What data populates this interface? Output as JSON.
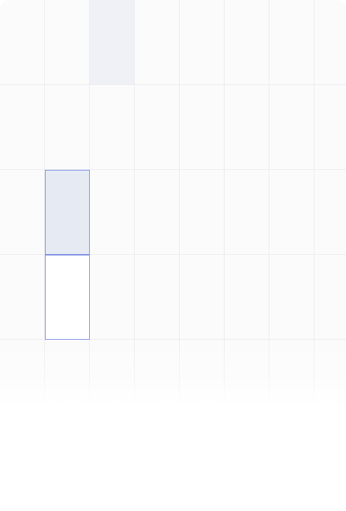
{
  "grid": {
    "rows": 5,
    "columns": 8,
    "highlighted_cell": {
      "row": 0,
      "column": 2
    },
    "selected_cell": {
      "row": 2,
      "column": 1
    },
    "outlined_cell": {
      "row": 3,
      "column": 1
    }
  },
  "colors": {
    "background": "#fbfbfc",
    "grid_line": "#ececef",
    "highlight": "#eff1f6",
    "selection_fill": "#e5eaf3",
    "selection_border": "#7f8fe6"
  }
}
